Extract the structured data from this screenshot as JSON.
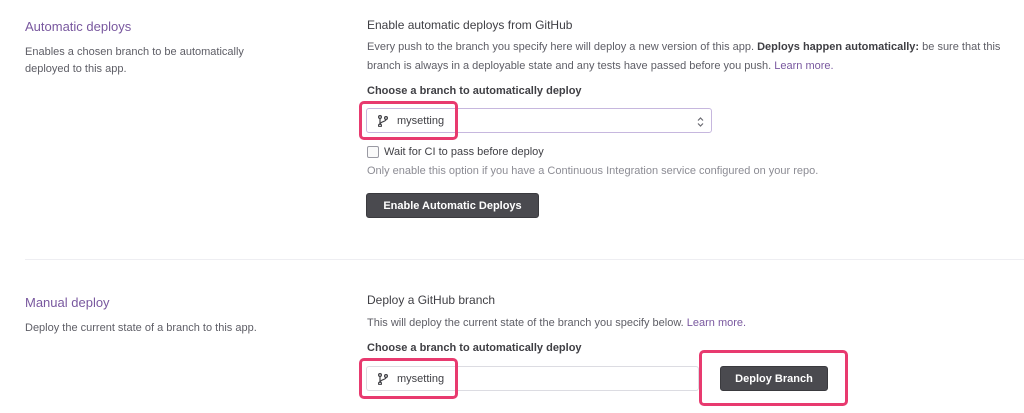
{
  "automatic": {
    "title": "Automatic deploys",
    "description": "Enables a chosen branch to be automatically deployed to this app.",
    "heading": "Enable automatic deploys from GitHub",
    "paragraph_part1": "Every push to the branch you specify here will deploy a new version of this app. ",
    "paragraph_bold": "Deploys happen automatically:",
    "paragraph_part2": " be sure that this branch is always in a deployable state and any tests have passed before you push. ",
    "learn_more": "Learn more.",
    "choose_label": "Choose a branch to automatically deploy",
    "branch_value": "mysetting",
    "ci_checkbox_label": "Wait for CI to pass before deploy",
    "ci_checked": false,
    "ci_hint": "Only enable this option if you have a Continuous Integration service configured on your repo.",
    "enable_button": "Enable Automatic Deploys"
  },
  "manual": {
    "title": "Manual deploy",
    "description": "Deploy the current state of a branch to this app.",
    "heading": "Deploy a GitHub branch",
    "paragraph": "This will deploy the current state of the branch you specify below. ",
    "learn_more": "Learn more.",
    "choose_label": "Choose a branch to automatically deploy",
    "branch_value": "mysetting",
    "deploy_button": "Deploy Branch"
  },
  "colors": {
    "accent": "#79589f",
    "highlight": "#e83a6f",
    "button": "#4a4a4f"
  },
  "icons": {
    "branch": "git-branch-icon",
    "select_arrows": "chevron-up-down-icon",
    "checkbox": "checkbox-icon"
  }
}
